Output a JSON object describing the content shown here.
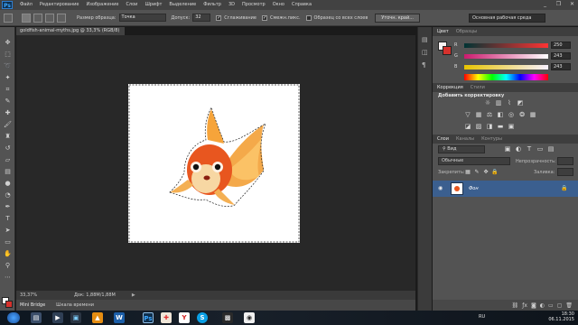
{
  "app": {
    "logo": "Ps",
    "menu": [
      "Файл",
      "Редактирование",
      "Изображение",
      "Слои",
      "Шрифт",
      "Выделение",
      "Фильтр",
      "3D",
      "Просмотр",
      "Окно",
      "Справка"
    ],
    "window_controls": [
      "_",
      "❐",
      "✕"
    ]
  },
  "options_bar": {
    "sample_size_label": "Размер образца:",
    "sample_size_value": "Точка",
    "tolerance_label": "Допуск:",
    "tolerance_value": "32",
    "antialias_label": "Сглаживание",
    "contiguous_label": "Смежн.пикс.",
    "all_layers_label": "Образец со всех слоев",
    "refine_button": "Уточн. край...",
    "workspace": "Основная рабочая среда"
  },
  "document": {
    "tab_title": "goldfish-animal-myths.jpg @ 33,3% (RGB/8)",
    "zoom": "33,37%",
    "doc_info": "Док: 1,88М/1,88М"
  },
  "bottom_tabs": [
    "Mini Bridge",
    "Шкала времени"
  ],
  "color_panel": {
    "tabs": [
      "Цвет",
      "Образцы"
    ],
    "sliders": [
      {
        "label": "R",
        "value": "250"
      },
      {
        "label": "G",
        "value": "243"
      },
      {
        "label": "B",
        "value": "243"
      }
    ],
    "fg_color": "#faf3f3",
    "bg_color": "#d6312c"
  },
  "adjustments_panel": {
    "tabs": [
      "Коррекция",
      "Стили"
    ],
    "subtitle": "Добавить корректировку"
  },
  "layers_panel": {
    "tabs": [
      "Слои",
      "Каналы",
      "Контуры"
    ],
    "filter_label": "Вид",
    "blend_mode": "Обычные",
    "opacity_label": "Непрозрачность:",
    "lock_label": "Закрепить:",
    "fill_label": "Заливка:",
    "layer_name": "Фон"
  },
  "taskbar": {
    "language": "RU",
    "time": "18:30",
    "date": "06.11.2015"
  }
}
